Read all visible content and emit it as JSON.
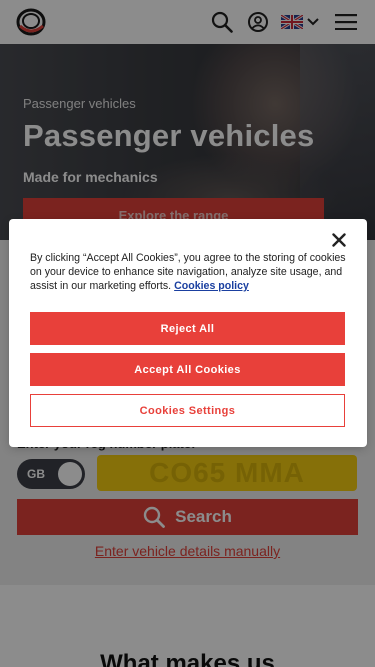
{
  "header": {
    "logo_icon": "brand-ring-logo",
    "icons": [
      "search-icon",
      "user-account-icon",
      "uk-flag-icon",
      "chevron-down-icon",
      "hamburger-menu-icon"
    ]
  },
  "hero": {
    "eyebrow": "Passenger vehicles",
    "title": "Passenger vehicles",
    "subtitle": "Made for mechanics",
    "cta_label": "Explore the range"
  },
  "lookup": {
    "label": "Enter your reg number plate:",
    "country_toggle": "GB",
    "plate_placeholder": "CO65 MMA",
    "search_label": "Search",
    "manual_link": "Enter vehicle details manually"
  },
  "section": {
    "heading": "What makes us"
  },
  "cookie_dialog": {
    "body": "By clicking “Accept All Cookies”, you agree to the storing of cookies on your device to enhance site navigation, analyze site usage, and assist in our marketing efforts.",
    "policy_link": "Cookies policy",
    "reject_label": "Reject All",
    "accept_label": "Accept All Cookies",
    "settings_label": "Cookies Settings"
  },
  "colors": {
    "accent": "#e8403a",
    "plate": "#f5cc12",
    "link_blue": "#1a3fa0"
  }
}
